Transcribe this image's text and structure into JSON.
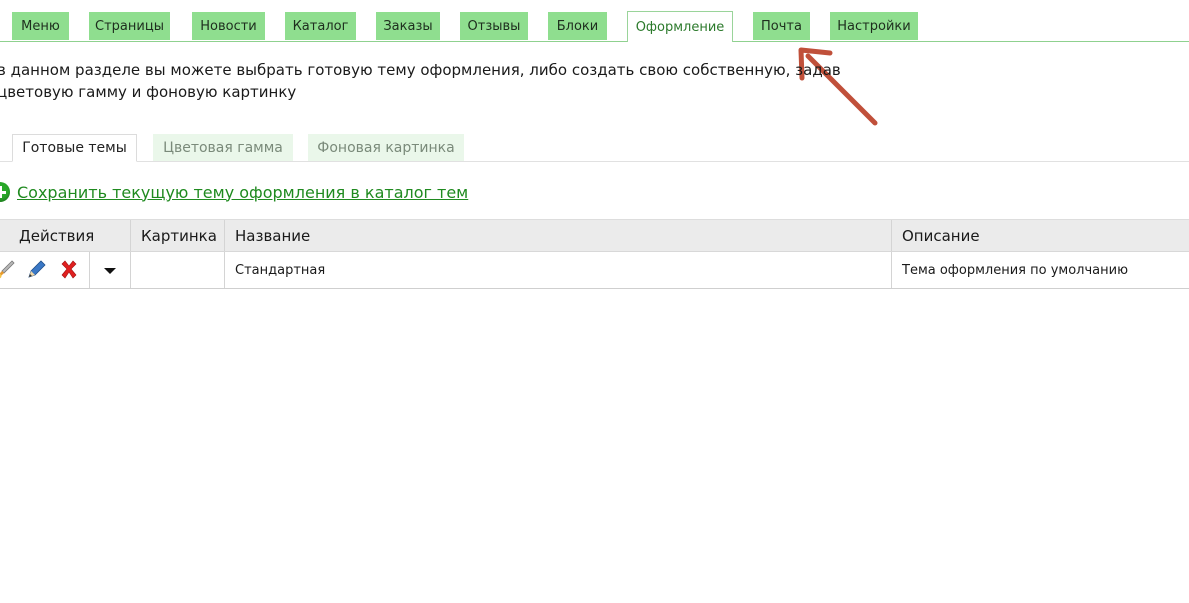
{
  "nav": {
    "tabs": [
      {
        "label": "Меню"
      },
      {
        "label": "Страницы"
      },
      {
        "label": "Новости"
      },
      {
        "label": "Каталог"
      },
      {
        "label": "Заказы"
      },
      {
        "label": "Отзывы"
      },
      {
        "label": "Блоки"
      },
      {
        "label": "Оформление",
        "active": true
      },
      {
        "label": "Почта"
      },
      {
        "label": "Настройки"
      }
    ]
  },
  "description": {
    "line1": "в данном разделе вы можете выбрать готовую тему оформления, либо создать свою собственную, задав",
    "line2": "цветовую гамму и фоновую картинку"
  },
  "subtabs": [
    {
      "label": "Готовые темы",
      "active": true
    },
    {
      "label": "Цветовая гамма"
    },
    {
      "label": "Фоновая картинка"
    }
  ],
  "save_link": {
    "label": "Сохранить текущую тему оформления в каталог тем"
  },
  "table": {
    "headers": {
      "actions": "Действия",
      "image": "Картинка",
      "name": "Название",
      "description": "Описание"
    },
    "rows": [
      {
        "image": "",
        "name": "Стандартная",
        "description": "Тема оформления по умолчанию"
      }
    ]
  },
  "colors": {
    "tab_bg": "#8fde8f",
    "active_tab_text": "#2c7a2c",
    "link": "#1f8a1f",
    "annotation_arrow": "#c0503a",
    "delete_icon": "#e02020"
  }
}
